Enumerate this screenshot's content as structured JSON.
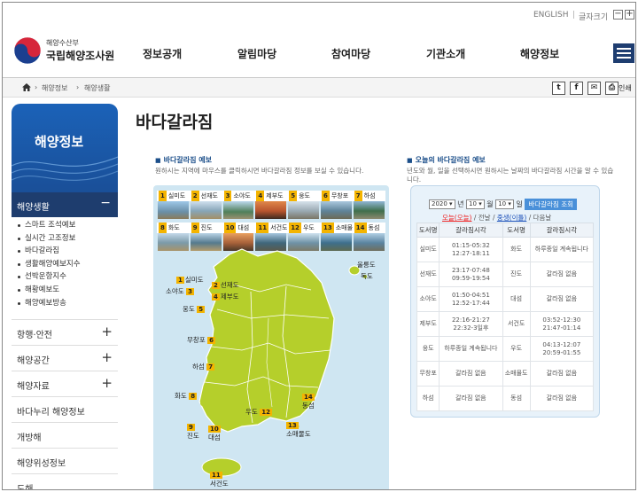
{
  "util": {
    "english": "ENGLISH",
    "sep": "|",
    "fontsize": "글자크기",
    "minus": "−",
    "plus": "+"
  },
  "logo": {
    "sub": "해양수산부",
    "main": "국립해양조사원"
  },
  "gnb": [
    "정보공개",
    "알림마당",
    "참여마당",
    "기관소개",
    "해양정보"
  ],
  "breadcrumb": [
    "해양정보",
    "해양생활"
  ],
  "share": {
    "twitter": "t",
    "facebook": "f",
    "mail": "✉",
    "print": "⎙",
    "print_label": "인쇄"
  },
  "sidebar": {
    "title": "해양정보",
    "active": "해양생활",
    "sub_items": [
      "스마트 조석예보",
      "실시간 고조정보",
      "바다갈라짐",
      "생활해양예보지수",
      "선박운항지수",
      "해황예보도",
      "해양예보방송"
    ],
    "rows": [
      {
        "label": "항행·안전",
        "expand": true
      },
      {
        "label": "해양공간",
        "expand": true
      },
      {
        "label": "해양자료",
        "expand": true
      },
      {
        "label": "바다누리 해양정보",
        "expand": false
      },
      {
        "label": "개방해",
        "expand": false
      },
      {
        "label": "해양위성정보",
        "expand": false
      },
      {
        "label": "도해",
        "expand": false
      }
    ]
  },
  "page": {
    "title": "바다갈라짐",
    "left_title": "바다갈라짐 예보",
    "left_desc": "원하시는 지역에 마우스를 클릭하시면 바다갈라짐 정보를 보실 수 있습니다.",
    "right_title": "오늘의 바다갈라짐 예보",
    "right_desc": "년도와 월, 일을 선택하시면 원하시는 날짜의 바다갈라짐 시간을 알 수 있습니다."
  },
  "thumbs_row1": [
    {
      "n": "1",
      "name": "실미도"
    },
    {
      "n": "2",
      "name": "선재도"
    },
    {
      "n": "3",
      "name": "소야도"
    },
    {
      "n": "4",
      "name": "제부도"
    },
    {
      "n": "5",
      "name": "웅도"
    },
    {
      "n": "6",
      "name": "무창포"
    },
    {
      "n": "7",
      "name": "하섬"
    }
  ],
  "thumbs_row2": [
    {
      "n": "8",
      "name": "화도"
    },
    {
      "n": "9",
      "name": "진도"
    },
    {
      "n": "10",
      "name": "대섬"
    },
    {
      "n": "11",
      "name": "서건도"
    },
    {
      "n": "12",
      "name": "우도"
    },
    {
      "n": "13",
      "name": "소매물도"
    },
    {
      "n": "14",
      "name": "동섬"
    }
  ],
  "map_pins": [
    {
      "n": "1",
      "name": "실미도"
    },
    {
      "n": "2",
      "name": "선재도"
    },
    {
      "n": "3",
      "name": "소야도"
    },
    {
      "n": "4",
      "name": "제부도"
    },
    {
      "n": "5",
      "name": "웅도"
    },
    {
      "n": "6",
      "name": "무창포"
    },
    {
      "n": "7",
      "name": "하섬"
    },
    {
      "n": "8",
      "name": "화도"
    },
    {
      "n": "9",
      "name": "진도"
    },
    {
      "n": "10",
      "name": "대섬"
    },
    {
      "n": "11",
      "name": "서건도"
    },
    {
      "n": "12",
      "name": "우도"
    },
    {
      "n": "13",
      "name": "소매물도"
    },
    {
      "n": "14",
      "name": "동섬"
    }
  ],
  "map_extra": [
    "울릉도",
    "독도"
  ],
  "date": {
    "year": "2020",
    "year_unit": "년",
    "month": "10",
    "month_unit": "월",
    "day": "10",
    "day_unit": "일",
    "button": "바다갈라짐 조회"
  },
  "legend": {
    "today": "오늘(오늘)",
    "prev": "전날",
    "sep1": " / ",
    "next_lbl": "중생(이틀)",
    "after": "다음날",
    "slash": " / "
  },
  "table": {
    "headers": [
      "도서명",
      "갈라짐시각",
      "도서명",
      "갈라짐시각"
    ],
    "rows": [
      [
        "실미도",
        "01:15-05:32\n12:27-18:11",
        "화도",
        "하루종일 계속됩니다"
      ],
      [
        "선재도",
        "23:17-07:48\n09:59-19:54",
        "진도",
        "갈라짐 없음"
      ],
      [
        "소야도",
        "01:50-04:51\n12:52-17:44",
        "대섬",
        "갈라짐 없음"
      ],
      [
        "제부도",
        "22:16-21:27\n22:32-3일후",
        "서건도",
        "03:52-12:30\n21:47-01:14"
      ],
      [
        "웅도",
        "하루종일 계속됩니다",
        "우도",
        "04:13-12:07\n20:59-01:55"
      ],
      [
        "무창포",
        "갈라짐 없음",
        "소매물도",
        "갈라짐 없음"
      ],
      [
        "하섬",
        "갈라짐 없음",
        "동섬",
        "갈라짐 없음"
      ]
    ]
  },
  "colors": {
    "brand_blue": "#1e3d6e",
    "accent_yellow": "#f4b400",
    "map_land": "#b5cf2b",
    "sea": "#cfe6f2"
  }
}
